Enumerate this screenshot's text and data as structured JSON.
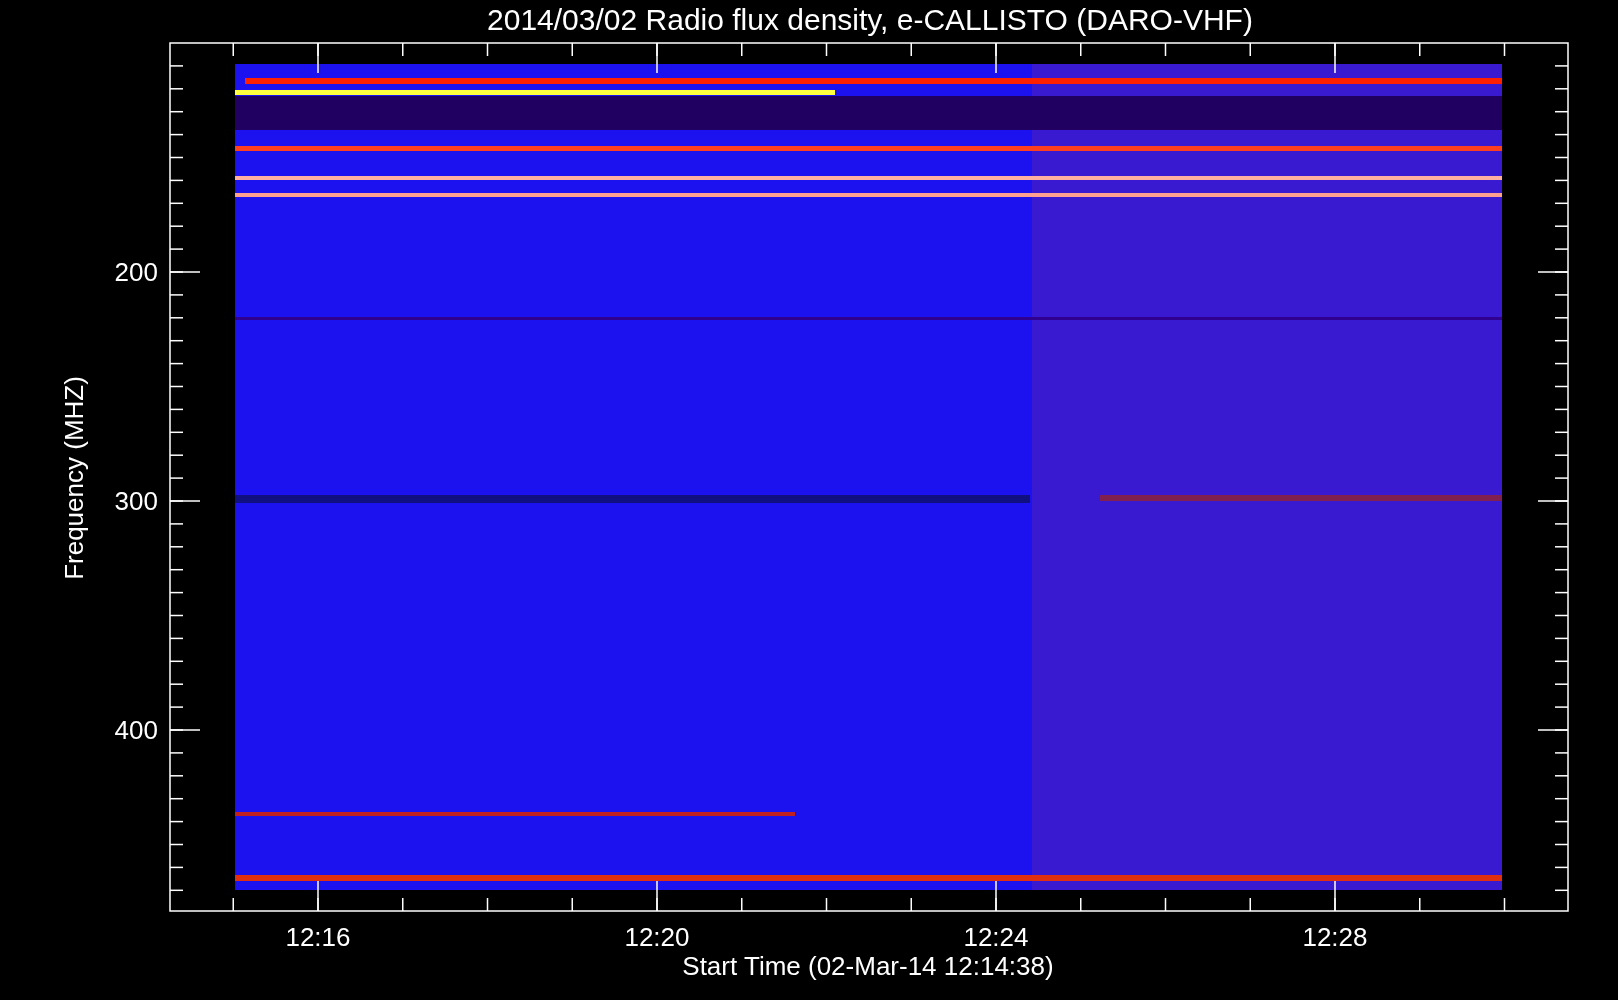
{
  "title": "2014/03/02  Radio flux density, e-CALLISTO (DARO-VHF)",
  "y_axis": {
    "label": "Frequency (MHZ)",
    "tick_labels": [
      "200",
      "300",
      "400"
    ]
  },
  "x_axis": {
    "label": "Start Time (02-Mar-14 12:14:38)",
    "tick_labels": [
      "12:16",
      "12:20",
      "12:24",
      "12:28"
    ]
  }
}
